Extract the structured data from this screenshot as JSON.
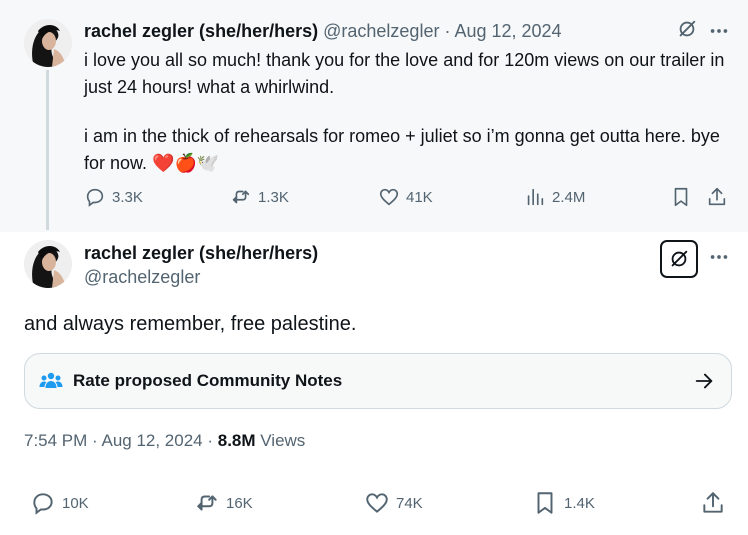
{
  "parent_tweet": {
    "display_name": "rachel zegler (she/her/hers)",
    "handle": "@rachelzegler",
    "separator": " · ",
    "date": "Aug 12, 2024",
    "paragraph1": "i love you all so much! thank you for the love and for 120m views on our trailer in just 24 hours! what a whirlwind.",
    "paragraph2": "i am in the thick of rehearsals for romeo + juliet so i’m gonna get outta here. bye for now. ❤️🍎🕊️",
    "replies": "3.3K",
    "reposts": "1.3K",
    "likes": "41K",
    "views": "2.4M"
  },
  "main_tweet": {
    "display_name": "rachel zegler (she/her/hers)",
    "handle": "@rachelzegler",
    "text": "and always remember, free palestine.",
    "community_notes_label": "Rate proposed Community Notes",
    "time": "7:54 PM",
    "meta_sep": " · ",
    "date": "Aug 12, 2024",
    "dot": " · ",
    "view_count": "8.8M",
    "views_label": " Views",
    "replies": "10K",
    "reposts": "16K",
    "likes": "74K",
    "bookmarks": "1.4K"
  },
  "icons": {
    "grok": "grok-icon",
    "more": "more-icon",
    "reply": "reply-icon",
    "repost": "repost-icon",
    "like": "heart-icon",
    "views": "views-icon",
    "bookmark": "bookmark-icon",
    "share": "share-icon",
    "community": "community-notes-icon",
    "arrow": "arrow-right-icon"
  },
  "colors": {
    "text": "#0f1419",
    "muted": "#536471",
    "notes_icon": "#1d9bf0",
    "parent_bg": "#f7f8f9",
    "thread_line": "#cfd9de"
  }
}
